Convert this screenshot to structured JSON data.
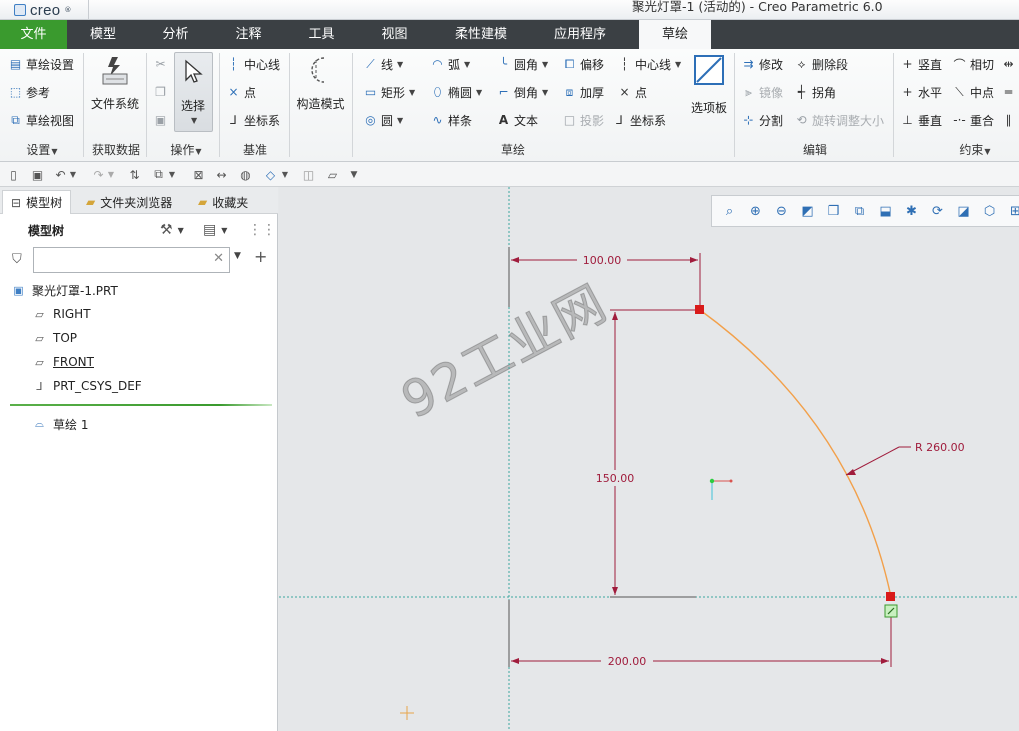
{
  "window": {
    "brand": "creo",
    "title": "聚光灯罩-1 (活动的) - Creo Parametric 6.0"
  },
  "tabs": {
    "file": "文件",
    "model": "模型",
    "analysis": "分析",
    "annotate": "注释",
    "tools": "工具",
    "view": "视图",
    "flexible": "柔性建模",
    "apps": "应用程序",
    "sketch": "草绘"
  },
  "ribbon": {
    "setup": {
      "sketch_setup": "草绘设置",
      "references": "参考",
      "sketch_view": "草绘视图",
      "label": "设置"
    },
    "get_data": {
      "file_system": "文件系统",
      "label": "获取数据"
    },
    "operations": {
      "select": "选择",
      "label": "操作"
    },
    "datum": {
      "centerline": "中心线",
      "point": "点",
      "csys": "坐标系",
      "label": "基准"
    },
    "construction": {
      "mode": "构造模式"
    },
    "sketching": {
      "line": "线",
      "arc": "弧",
      "fillet": "圆角",
      "offset": "偏移",
      "centerline": "中心线",
      "rectangle": "矩形",
      "ellipse": "椭圆",
      "chamfer": "倒角",
      "thicken": "加厚",
      "point": "点",
      "circle": "圆",
      "spline": "样条",
      "text": "文本",
      "project": "投影",
      "csys": "坐标系",
      "palette": "选项板",
      "label": "草绘"
    },
    "editing": {
      "modify": "修改",
      "delete_segment": "删除段",
      "mirror": "镜像",
      "corner": "拐角",
      "divide": "分割",
      "rotate_resize": "旋转调整大小",
      "label": "编辑"
    },
    "constrain": {
      "vertical": "竖直",
      "tangent": "相切",
      "horizontal": "水平",
      "midpoint": "中点",
      "perpendicular": "垂直",
      "coincident": "重合",
      "label": "约束"
    }
  },
  "panel": {
    "tabs": {
      "model_tree": "模型树",
      "folder_browser": "文件夹浏览器",
      "favorites": "收藏夹"
    },
    "tree_header": "模型树",
    "search_placeholder": "",
    "items": {
      "part": "聚光灯罩-1.PRT",
      "right": "RIGHT",
      "top": "TOP",
      "front": "FRONT",
      "csys": "PRT_CSYS_DEF",
      "sketch": "草绘 1"
    }
  },
  "sketch": {
    "dim_top": "100.00",
    "dim_height": "150.00",
    "dim_radius": "R 260.00",
    "dim_bottom": "200.00",
    "watermark": "92工业网"
  }
}
